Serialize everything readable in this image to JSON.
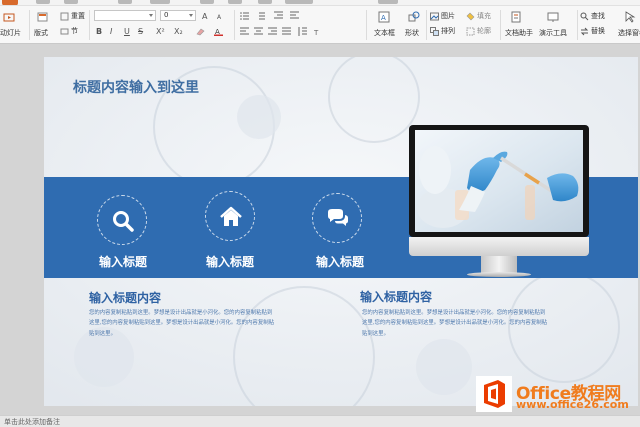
{
  "ribbon": {
    "left": {
      "start_slide_label": "从当前开始",
      "start_slide_short": "动灯片"
    },
    "groups": {
      "layout_label": "版式",
      "reset_label": "重置",
      "section_label": "节"
    },
    "font": {
      "family": "",
      "size": "0"
    },
    "format_buttons": [
      "B",
      "I",
      "U",
      "S",
      "X²",
      "X₂"
    ],
    "tools": {
      "textbox_label": "文本框",
      "shape_label": "形状",
      "arrange_label": "排列",
      "picture_label": "图片",
      "fill_label": "填充",
      "outline_label": "轮廓",
      "doc_assistant_label": "文档助手",
      "presentation_tools_label": "演示工具",
      "find_label": "查找",
      "replace_label": "替换",
      "select_pane_label": "选择窗格"
    }
  },
  "slide": {
    "title": "标题内容输入到这里",
    "features": [
      {
        "label": "输入标题",
        "icon": "search-icon"
      },
      {
        "label": "输入标题",
        "icon": "home-icon"
      },
      {
        "label": "输入标题",
        "icon": "chat-bubbles-icon"
      }
    ],
    "left_section": {
      "title": "输入标题内容",
      "lines": [
        "您的内容复制粘贴到这里。梦想是设计出品就是小河化。您的内容复制粘贴到",
        "这里,您的内容复制粘贴到这里。梦想是设计出品就是小河化。您的内容复制粘",
        "贴到这里。"
      ]
    },
    "right_section": {
      "title": "输入标题内容",
      "lines": [
        "您的内容复制粘贴到这里。梦想是设计出品就是小河化。您的内容复制粘贴到",
        "这里,您的内容复制粘贴到这里。梦想是设计出品就是小河化。您的内容复制粘",
        "贴到这里。"
      ]
    },
    "colors": {
      "band": "#2f6cb1",
      "title": "#3f6ea2",
      "section_title": "#2f62a3"
    }
  },
  "status": {
    "text": "单击此处添加备注"
  },
  "watermark": {
    "brand": "Office教程网",
    "url": "www.office26.com"
  }
}
